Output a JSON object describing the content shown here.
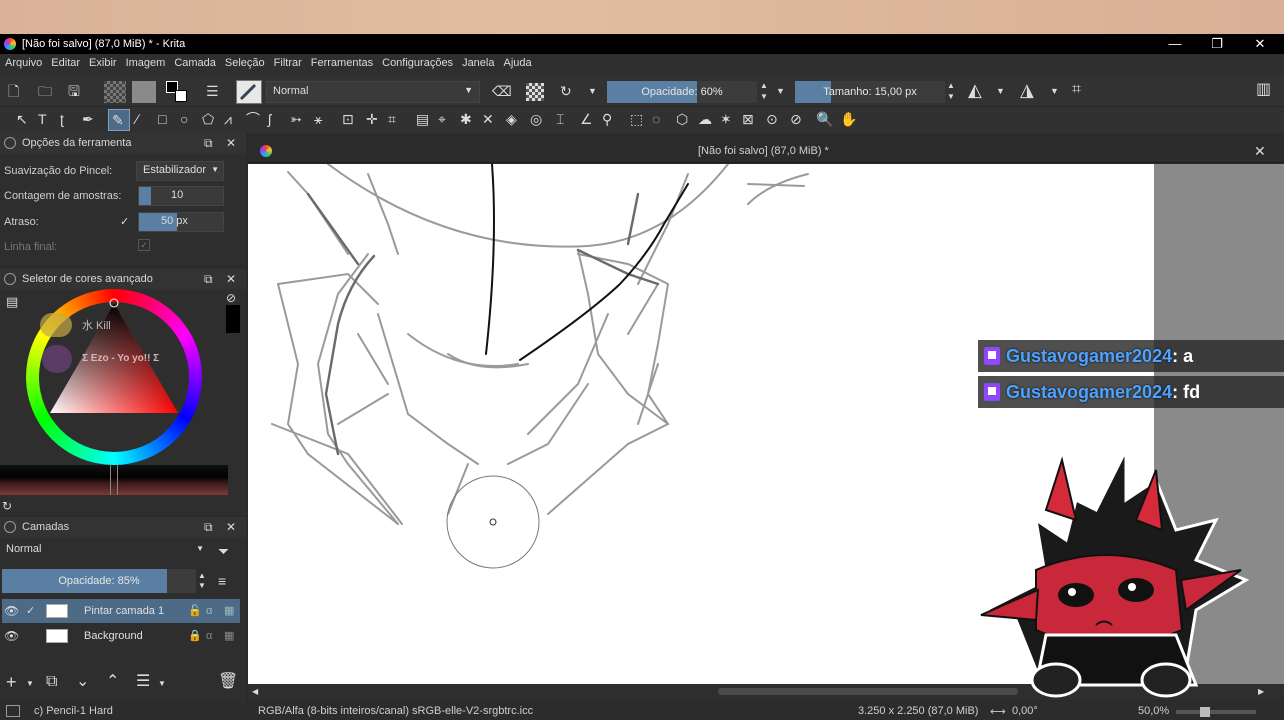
{
  "window": {
    "title": "[Não foi salvo]  (87,0 MiB) * - Krita",
    "minimize": "—",
    "maximize": "❐",
    "close": "✕"
  },
  "menu": [
    "Arquivo",
    "Editar",
    "Exibir",
    "Imagem",
    "Camada",
    "Seleção",
    "Filtrar",
    "Ferramentas",
    "Configurações",
    "Janela",
    "Ajuda"
  ],
  "toolbar": {
    "blend_mode": "Normal",
    "opacity_label": "Opacidade: 60%",
    "opacity_value": 0.6,
    "size_label": "Tamanho: 15,00 px"
  },
  "tool_options": {
    "title": "Opções da ferramenta",
    "smoothing_label": "Suavização do Pincel:",
    "smoothing_value": "Estabilizador",
    "samples_label": "Contagem de amostras:",
    "samples_value": "10",
    "delay_label": "Atraso:",
    "delay_value": "50 px",
    "finish_label": "Linha final:"
  },
  "color_selector": {
    "title": "Seletor de cores avançado"
  },
  "layers": {
    "title": "Camadas",
    "blend_mode": "Normal",
    "opacity_label": "Opacidade:  85%",
    "opacity_value": 0.85,
    "items": [
      {
        "name": "Pintar camada 1",
        "selected": true
      },
      {
        "name": "Background",
        "selected": false
      }
    ]
  },
  "canvas": {
    "tab_title": "[Não foi salvo]  (87,0 MiB) *"
  },
  "overlay": {
    "badge1": "水 Kill",
    "badge2": "Σ Ezo - Yo yo!! Σ",
    "chat": [
      {
        "user": "Gustavogamer2024",
        "message": ": a"
      },
      {
        "user": "Gustavogamer2024",
        "message": ": fd"
      }
    ]
  },
  "status": {
    "brush": "c) Pencil-1 Hard",
    "color_space": "RGB/Alfa (8-bits inteiros/canal)  sRGB-elle-V2-srgbtrc.icc",
    "image_size": "3.250 x 2.250 (87,0 MiB)",
    "rotation": "0,00°",
    "zoom": "50,0%"
  },
  "colors": {
    "accent": "#5a7fa3",
    "twitch": "#9146ff",
    "chat_user": "#4da3ff"
  }
}
